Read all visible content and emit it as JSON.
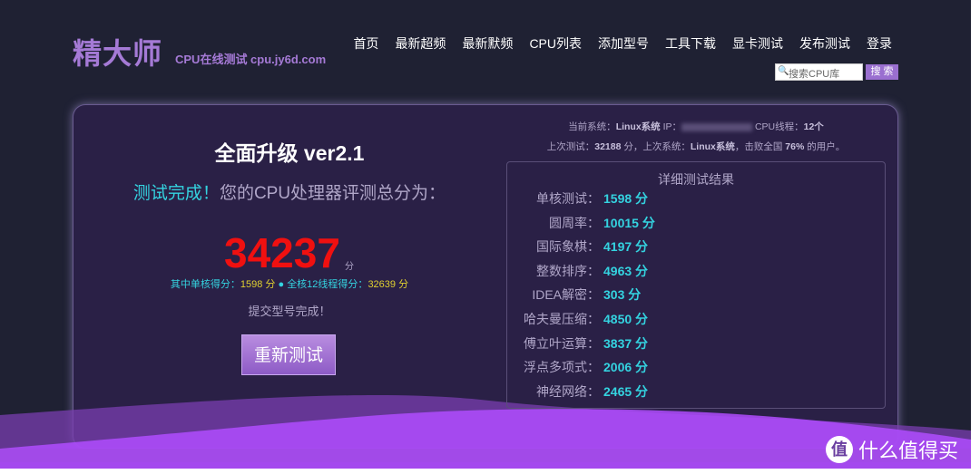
{
  "header": {
    "logo": "精大师",
    "subtitle": "CPU在线测试 cpu.jy6d.com",
    "nav": [
      "首页",
      "最新超频",
      "最新默频",
      "CPU列表",
      "添加型号",
      "工具下载",
      "显卡测试",
      "发布测试",
      "登录"
    ],
    "search_placeholder": "搜索CPU库",
    "search_button": "搜 索"
  },
  "main": {
    "title": "全面升级 ver2.1",
    "done_label": "测试完成！",
    "done_text": "您的CPU处理器评测总分为：",
    "score": "34237",
    "score_unit": "分",
    "single_label": "其中单核得分：",
    "single_value": "1598 分",
    "separator": " ● ",
    "multi_label": "全核12线程得分：",
    "multi_value": "32639 分",
    "submit_status": "提交型号完成！",
    "retest_button": "重新测试"
  },
  "info": {
    "system_label": "当前系统：",
    "system": "Linux系统",
    "ip_label": " IP：",
    "threads_label": "CPU线程：",
    "threads": "12个",
    "last_label": "上次测试：",
    "last_score": "32188",
    "last_mid": " 分，上次系统：",
    "last_system": "Linux系统",
    "beat_label": "，击败全国 ",
    "beat": "76%",
    "beat_tail": " 的用户。"
  },
  "results": {
    "title": "详细测试结果",
    "items": [
      {
        "label": "单核测试：",
        "value": "1598 分"
      },
      {
        "label": "圆周率：",
        "value": "10015 分"
      },
      {
        "label": "国际象棋：",
        "value": "4197 分"
      },
      {
        "label": "整数排序：",
        "value": "4963 分"
      },
      {
        "label": "IDEA解密：",
        "value": "303 分"
      },
      {
        "label": "哈夫曼压缩：",
        "value": "4850 分"
      },
      {
        "label": "傅立叶运算：",
        "value": "3837 分"
      },
      {
        "label": "浮点多项式：",
        "value": "2006 分"
      },
      {
        "label": "神经网络：",
        "value": "2465 分"
      }
    ]
  },
  "watermark": {
    "icon": "值",
    "text": "什么值得买"
  }
}
